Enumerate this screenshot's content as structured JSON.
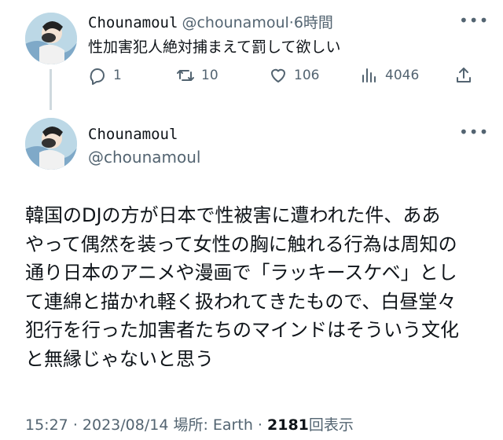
{
  "reply": {
    "display_name": "Chounamoul",
    "handle": "@chounamoul",
    "separator": "·",
    "time": "6時間",
    "text": "性加害犯人絶対捕まえて罰して欲しい",
    "actions": {
      "replies": "1",
      "retweets": "10",
      "likes": "106",
      "views": "4046"
    }
  },
  "tweet": {
    "display_name": "Chounamoul",
    "handle": "@chounamoul",
    "body_lines": [
      "韓国のDJの方が日本で性被害に遭われた件、ああ",
      "やって偶然を装って女性の胸に触れる行為は周知の",
      "通り日本のアニメや漫画で「ラッキースケベ」とし",
      "て連綿と描かれ軽く扱われてきたもので、白昼堂々",
      "犯行を行った加害者たちのマインドはそういう文化",
      "と無縁じゃないと思う"
    ],
    "meta": {
      "time": "15:27",
      "date": "2023/08/14",
      "location_label": "場所: Earth",
      "views_count": "2181",
      "views_label": "回表示",
      "sep": "·"
    }
  },
  "icons": {
    "reply": "reply-icon",
    "retweet": "retweet-icon",
    "like": "heart-icon",
    "views": "views-icon",
    "share": "share-icon",
    "more": "more-icon"
  }
}
